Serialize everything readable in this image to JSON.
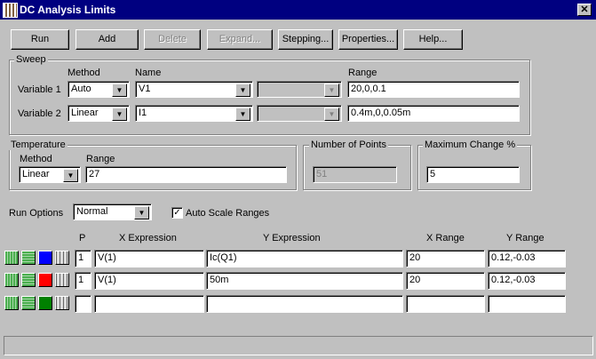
{
  "title": "DC Analysis Limits",
  "toolbar": {
    "run": "Run",
    "add": "Add",
    "delete": "Delete",
    "expand": "Expand...",
    "stepping": "Stepping...",
    "properties": "Properties...",
    "help": "Help..."
  },
  "sweep": {
    "label": "Sweep",
    "method_header": "Method",
    "name_header": "Name",
    "range_header": "Range",
    "variables": [
      {
        "label": "Variable 1",
        "method": "Auto",
        "name": "V1",
        "range": "20,0,0.1"
      },
      {
        "label": "Variable 2",
        "method": "Linear",
        "name": "I1",
        "range": "0.4m,0,0.05m"
      }
    ]
  },
  "temperature": {
    "label": "Temperature",
    "method_header": "Method",
    "range_header": "Range",
    "method": "Linear",
    "range": "27"
  },
  "number_of_points": {
    "label": "Number of Points",
    "value": "51"
  },
  "maximum_change": {
    "label": "Maximum Change %",
    "value": "5"
  },
  "run_options": {
    "label": "Run Options",
    "value": "Normal"
  },
  "auto_scale": {
    "label": "Auto Scale Ranges",
    "checked": true,
    "mark": "✓"
  },
  "table": {
    "headers": {
      "p": "P",
      "x": "X Expression",
      "y": "Y Expression",
      "xr": "X Range",
      "yr": "Y Range"
    },
    "rows": [
      {
        "color": "#0000ff",
        "p": "1",
        "x": "V(1)",
        "y": "Ic(Q1)",
        "xr": "20",
        "yr": "0.12,-0.03"
      },
      {
        "color": "#ff0000",
        "p": "1",
        "x": "V(1)",
        "y": "50m",
        "xr": "20",
        "yr": "0.12,-0.03"
      },
      {
        "color": "#008000",
        "p": "",
        "x": "",
        "y": "",
        "xr": "",
        "yr": ""
      }
    ]
  },
  "close": "✕"
}
